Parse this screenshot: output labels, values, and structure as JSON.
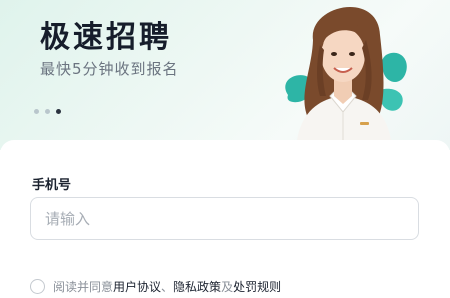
{
  "banner": {
    "title": "极速招聘",
    "subtitle": "最快5分钟收到报名",
    "slide_count": 3,
    "active_slide": 3
  },
  "form": {
    "phone_label": "手机号",
    "phone_placeholder": "请输入",
    "phone_value": ""
  },
  "agreement": {
    "checked": false,
    "prefix": "阅读并同意",
    "user_agreement": "用户协议",
    "separator": "、",
    "privacy_policy": "隐私政策",
    "conjunction": "及",
    "penalty_rules": "处罚规则"
  },
  "colors": {
    "title": "#161d2b",
    "accent_teal": "#2db5a6",
    "banner_bg": "#e6f5ef"
  }
}
